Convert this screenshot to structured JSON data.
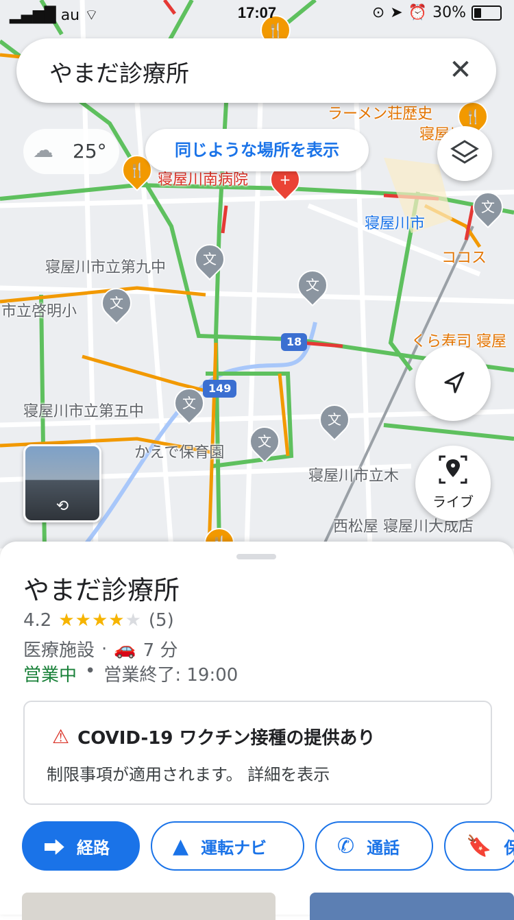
{
  "status_bar": {
    "carrier": "au",
    "time": "17:07",
    "battery": "30%"
  },
  "search": {
    "query": "やまだ診療所"
  },
  "weather": {
    "temperature": "25°"
  },
  "similar_places_label": "同じような場所を表示",
  "live_label": "ライブ",
  "map": {
    "labels": [
      "ラーメン荘歴史",
      "寝屋川",
      "寝屋川南病院",
      "寝屋川市",
      "ココス",
      "寝屋川市立第九中",
      "市立啓明小",
      "くら寿司 寝屋",
      "寝屋川市立第五中",
      "かえで保育園",
      "寝屋川市立木",
      "西松屋 寝屋川大成店"
    ],
    "route_18": "18",
    "route_149": "149"
  },
  "place": {
    "name": "やまだ診療所",
    "rating": "4.2",
    "stars": 4,
    "review_count": "(5)",
    "category": "医療施設",
    "drive_time": "7 分",
    "open_status": "営業中",
    "hours": "営業終了: 19:00",
    "covid_title": "COVID-19 ワクチン接種の提供あり",
    "covid_sub": "制限事項が適用されます。 詳細を表示"
  },
  "actions": {
    "directions": "経路",
    "navigate": "運転ナビ",
    "call": "通話",
    "save": "保"
  },
  "colors": {
    "accent": "#1a73e8",
    "open": "#188038",
    "star": "#f6b400",
    "warning": "#d93025"
  }
}
